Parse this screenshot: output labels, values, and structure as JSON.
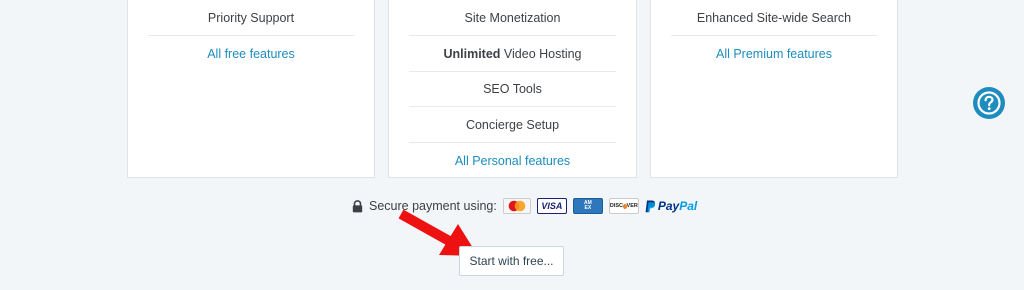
{
  "plans": [
    {
      "rows": [
        {
          "text": "Priority Support"
        }
      ],
      "link": "All free features"
    },
    {
      "rows": [
        {
          "text": "Site Monetization"
        },
        {
          "bold": "Unlimited",
          "text": " Video Hosting"
        },
        {
          "text": "SEO Tools"
        },
        {
          "text": "Concierge Setup"
        }
      ],
      "link": "All Personal features"
    },
    {
      "rows": [
        {
          "text": "Enhanced Site-wide Search"
        }
      ],
      "link": "All Premium features"
    }
  ],
  "secure_payment": {
    "label": "Secure payment using:",
    "methods": [
      "MasterCard",
      "VISA",
      "AMERICAN EXPRESS",
      "DISCOVER",
      "PayPal"
    ]
  },
  "start_button": {
    "label": "Start with free..."
  },
  "help": {
    "icon": "question-circle-icon"
  },
  "colors": {
    "background": "#f3f6f8",
    "link": "#1e8cbe",
    "help_button": "#1e8cbe",
    "arrow": "#ee1111"
  }
}
